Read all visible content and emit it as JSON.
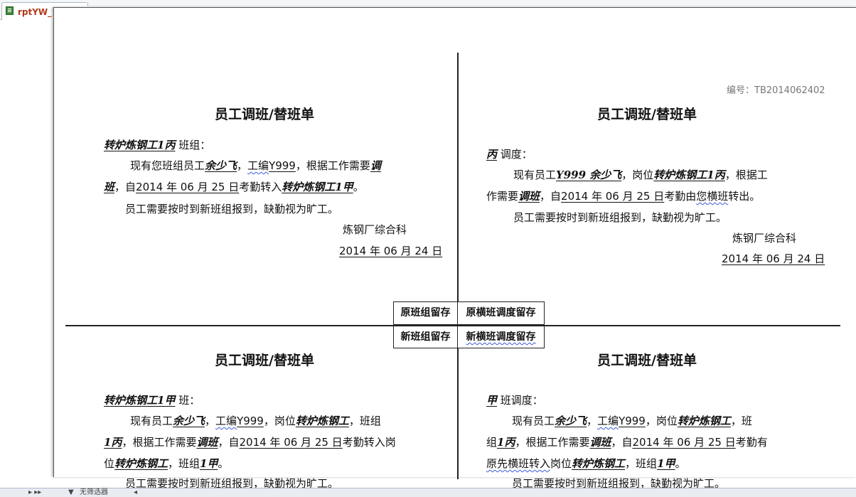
{
  "tab": {
    "title": "rptYW_调班替班"
  },
  "serial": "编号：TB2014062402",
  "quad_tl": {
    "title": "员工调班/替班单",
    "line1_group": "转炉炼钢工1丙",
    "line1_suffix": " 班组：",
    "line2_a": "现有您班组员工",
    "name": "余少飞",
    "sep1": "，",
    "emp_label": "工编",
    "emp_id": "Y999",
    "line2_b": "，根据工作需要",
    "reason_1": "调",
    "reason_2": "班",
    "line3_a": "，自",
    "date_from": "2014 年 06 月 25 日",
    "line3_b": "考勤转入",
    "target": "转炉炼钢工1甲",
    "line3_c": "。",
    "line4": "员工需要按时到新班组报到，缺勤视为旷工。",
    "dept": "炼钢厂综合科",
    "date_sign": "2014 年 06 月 24 日"
  },
  "quad_tr": {
    "title": "员工调班/替班单",
    "line1_group": "丙",
    "line1_suffix": " 调度：",
    "line2_a": "现有员工",
    "emp_name": "Y999 余少飞",
    "line2_b": "，岗位",
    "post": "转炉炼钢工1丙",
    "line2_c": "，根据工",
    "line3_a": "作需要",
    "reason": "调班",
    "line3_b": "，自",
    "date_from": "2014 年 06 月 25 日",
    "line3_c": "考勤由",
    "line3_wavy": "您横班",
    "line3_d": "转出。",
    "line4": "员工需要按时到新班组报到，缺勤视为旷工。",
    "dept": "炼钢厂综合科",
    "date_sign": "2014 年 06 月 24 日"
  },
  "stamps": {
    "tl": "原班组留存",
    "tr": "原横班调度留存",
    "bl": "新班组留存",
    "br": "新横班调度留存"
  },
  "quad_bl": {
    "title": "员工调班/替班单",
    "line1_group": "转炉炼钢工1甲",
    "line1_suffix": " 班：",
    "line2_a": "现有员工",
    "name": "余少飞",
    "line2_b": "，",
    "emp_label": "工编",
    "emp_id": "Y999",
    "line2_c": "，岗位",
    "post": "转炉炼钢工",
    "line2_d": "，班组",
    "group": "1丙",
    "line3_a": "，根据工作需要",
    "reason": "调班",
    "line3_b": "，自",
    "date_from": "2014 年 06 月 25 日",
    "line3_c": "考勤转入岗",
    "line4_a": "位",
    "new_post": "转炉炼钢工",
    "line4_b": "，班组",
    "new_group": "1甲",
    "line4_c": "。",
    "line5": "员工需要按时到新班组报到，缺勤视为旷工。"
  },
  "quad_br": {
    "title": "员工调班/替班单",
    "line1_group": "甲",
    "line1_suffix": " 班调度：",
    "line2_a": "现有员工",
    "name": "余少飞",
    "line2_b": "，",
    "emp_label": "工编",
    "emp_id": "Y999",
    "line2_c": "，岗位",
    "post": "转炉炼钢工",
    "line2_d": "，班",
    "line3_a": "组",
    "group": "1丙",
    "line3_b": "，根据工作需要",
    "reason": "调班",
    "line3_c": "，自",
    "date_from": "2014 年 06 月 25 日",
    "line3_d": "考勤有",
    "line4_wavy": "原先横班转入",
    "line4_a": "岗位",
    "new_post": "转炉炼钢工",
    "line4_b": "，班组",
    "new_group": "1甲",
    "line4_c": "。",
    "line5": "员工需要按时到新班组报到，缺勤视为旷工。"
  },
  "bottom": {
    "nav": "▸ ▸▸",
    "filter": "无筛选器"
  }
}
